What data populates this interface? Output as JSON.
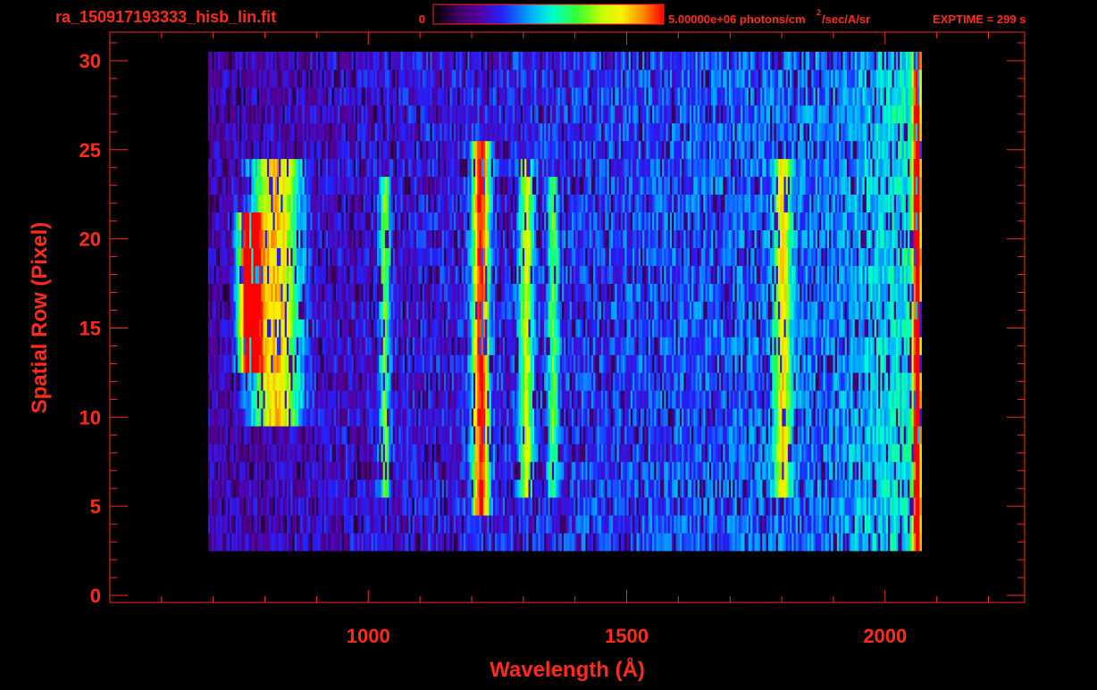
{
  "header": {
    "filename": "ra_150917193333_hisb_lin.fit",
    "colorbar_min_label": "0",
    "colorbar_max_label": "5.00000e+06 photons/cm",
    "colorbar_units_exponent": "2",
    "colorbar_units_rest": "/sec/A/sr",
    "exptime_label": "EXPTIME = 299 s"
  },
  "colors": {
    "background": "#000000",
    "axis_and_text": "#ff2a1a",
    "colormap": [
      "#000000",
      "#3b005a",
      "#5500a0",
      "#2222ff",
      "#00aaff",
      "#00ffcc",
      "#33ff33",
      "#ccff00",
      "#ffee00",
      "#ff8800",
      "#ff0000"
    ]
  },
  "chart_data": {
    "type": "heatmap",
    "title": "",
    "xlabel": "Wavelength (Å)",
    "ylabel": "Spatial Row (Pixel)",
    "xlim": [
      500,
      2270
    ],
    "ylim": [
      -0.4,
      31.6
    ],
    "xticks": [
      1000,
      1500,
      2000
    ],
    "yticks": [
      0,
      5,
      10,
      15,
      20,
      25,
      30
    ],
    "grid": false,
    "colorbar": {
      "min": 0,
      "max": 5000000,
      "units": "photons/cm^2/sec/A/sr",
      "position": "top"
    },
    "data_extent": {
      "x": [
        690,
        2070
      ],
      "y": [
        3,
        30
      ]
    },
    "emission_features": [
      {
        "center": 770,
        "width": 40,
        "y": [
          13,
          21
        ],
        "intensity": 1.0
      },
      {
        "center": 820,
        "width": 90,
        "y": [
          10,
          24
        ],
        "intensity": 0.6
      },
      {
        "center": 1030,
        "width": 20,
        "y": [
          6,
          23
        ],
        "intensity": 0.35
      },
      {
        "center": 1216,
        "width": 30,
        "y": [
          5,
          25
        ],
        "intensity": 0.75
      },
      {
        "center": 1304,
        "width": 25,
        "y": [
          6,
          24
        ],
        "intensity": 0.45
      },
      {
        "center": 1356,
        "width": 20,
        "y": [
          6,
          23
        ],
        "intensity": 0.3
      },
      {
        "center": 1800,
        "width": 30,
        "y": [
          6,
          24
        ],
        "intensity": 0.45
      },
      {
        "center": 2060,
        "width": 15,
        "y": [
          2,
          30
        ],
        "intensity": 0.7
      }
    ]
  }
}
